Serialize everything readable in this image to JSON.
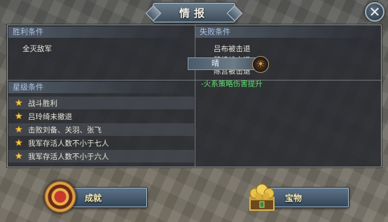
{
  "dialog": {
    "title": "情报",
    "close_glyph": "✕"
  },
  "victory": {
    "header": "胜利条件",
    "items": [
      "全灭敌军"
    ]
  },
  "defeat": {
    "header": "失败条件",
    "items": [
      "吕布被击退",
      "魏续被击退",
      "陈宫被击退"
    ]
  },
  "stars": {
    "header": "星级条件",
    "items": [
      "战斗胜利",
      "吕玲绮未撤退",
      "击败刘备、关羽、张飞",
      "我军存活人数不小于七人",
      "我军存活人数不小于六人"
    ]
  },
  "weather": {
    "label": "晴",
    "icon": "sun-icon",
    "effect": "-火系策略伤害提升",
    "effect_color": "#5de16b"
  },
  "buttons": {
    "achievement_label": "成就",
    "treasure_label": "宝物"
  },
  "colors": {
    "header_text": "#a9c4e6",
    "star": "#f2c443",
    "button_text": "#f6e9b3"
  }
}
